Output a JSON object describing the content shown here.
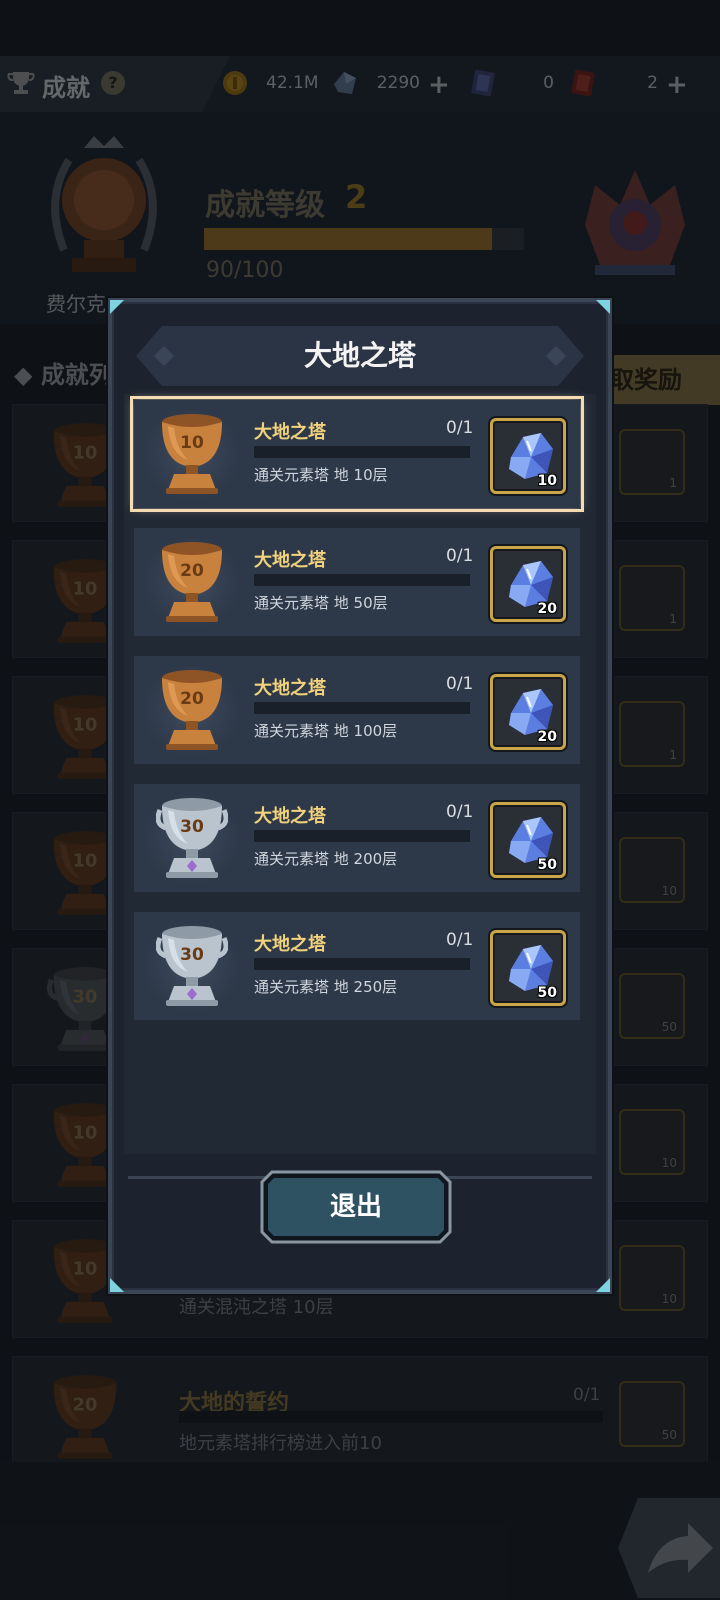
{
  "topbar": {
    "title": "成就",
    "help": "?",
    "resources": [
      {
        "name": "gold",
        "value": "42.1M",
        "has_plus": false
      },
      {
        "name": "crystal",
        "value": "2290",
        "has_plus": true
      },
      {
        "name": "ticket",
        "value": "0",
        "has_plus": false
      },
      {
        "name": "card",
        "value": "2",
        "has_plus": true
      }
    ]
  },
  "header": {
    "player_name": "费尔克",
    "level_label": "成就等级",
    "level_value": "2",
    "progress_text": "90/100",
    "progress_fraction": 0.9
  },
  "list": {
    "title": "◆ 成就列",
    "claim_label": "取奖励"
  },
  "background_rows": [
    {
      "cup": "10",
      "reward_count": "1"
    },
    {
      "cup": "10",
      "reward_count": "1"
    },
    {
      "cup": "10",
      "reward_count": "1"
    },
    {
      "cup": "10",
      "reward_count": "10"
    },
    {
      "cup": "30",
      "reward_count": "50"
    },
    {
      "cup": "10",
      "reward_count": "10"
    },
    {
      "cup": "10",
      "reward_count": "10",
      "desc": "通关混沌之塔 10层"
    },
    {
      "cup": "20",
      "reward_count": "50",
      "name": "大地的誓约",
      "desc": "地元素塔排行榜进入前10",
      "progress": "0/1"
    }
  ],
  "modal": {
    "title": "大地之塔",
    "exit_label": "退出",
    "tasks": [
      {
        "name": "大地之塔",
        "progress": "0/1",
        "desc": "通关元素塔 地 10层",
        "cup_level": "10",
        "cup_tier": "bronze",
        "reward_count": "10",
        "selected": true
      },
      {
        "name": "大地之塔",
        "progress": "0/1",
        "desc": "通关元素塔 地 50层",
        "cup_level": "20",
        "cup_tier": "bronze",
        "reward_count": "20",
        "selected": false
      },
      {
        "name": "大地之塔",
        "progress": "0/1",
        "desc": "通关元素塔 地 100层",
        "cup_level": "20",
        "cup_tier": "bronze",
        "reward_count": "20",
        "selected": false
      },
      {
        "name": "大地之塔",
        "progress": "0/1",
        "desc": "通关元素塔 地 200层",
        "cup_level": "30",
        "cup_tier": "silver",
        "reward_count": "50",
        "selected": false
      },
      {
        "name": "大地之塔",
        "progress": "0/1",
        "desc": "通关元素塔 地 250层",
        "cup_level": "30",
        "cup_tier": "silver",
        "reward_count": "50",
        "selected": false
      }
    ]
  },
  "colors": {
    "task_name": "#f2d27c",
    "reward_border": "#c9a548",
    "selected_outline": "#f4dcb2",
    "modal_bg": "#1c232e",
    "exit_button": "#2f5262"
  }
}
